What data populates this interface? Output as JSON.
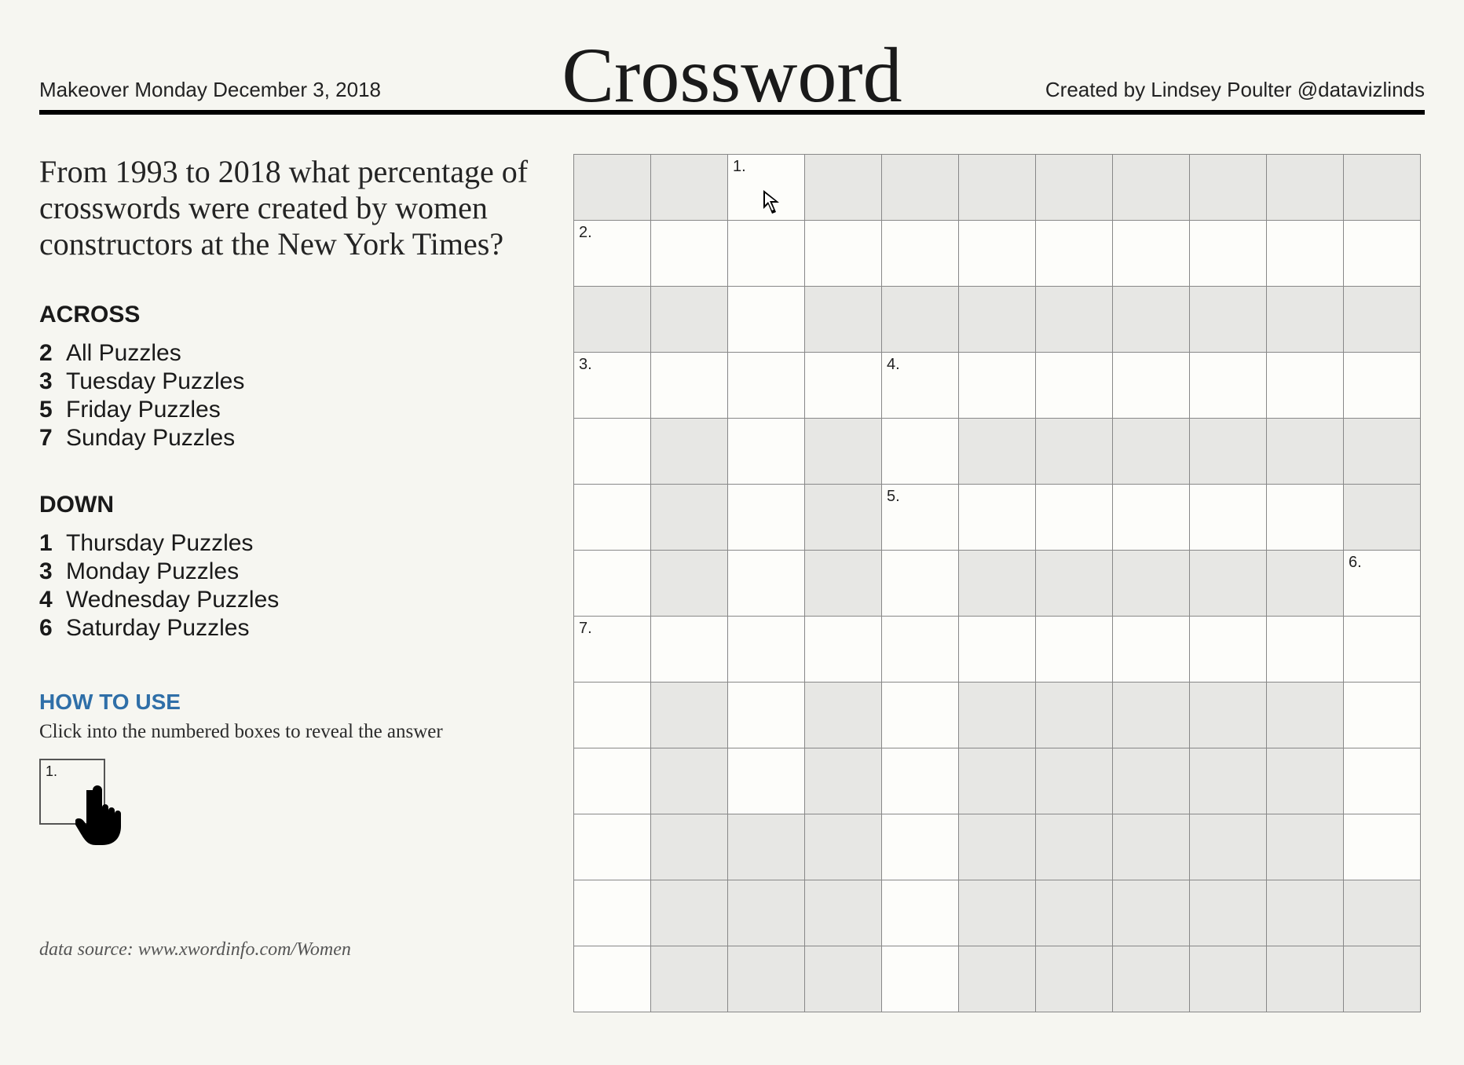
{
  "header": {
    "left": "Makeover Monday December 3, 2018",
    "title": "Crossword",
    "right": "Created by Lindsey Poulter @datavizlinds"
  },
  "question": "From 1993 to 2018 what percentage of crosswords were created by women constructors at the New York Times?",
  "across": {
    "heading": "ACROSS",
    "clues": [
      {
        "num": "2",
        "text": "All Puzzles"
      },
      {
        "num": "3",
        "text": "Tuesday Puzzles"
      },
      {
        "num": "5",
        "text": "Friday Puzzles"
      },
      {
        "num": "7",
        "text": "Sunday Puzzles"
      }
    ]
  },
  "down": {
    "heading": "DOWN",
    "clues": [
      {
        "num": "1",
        "text": "Thursday Puzzles"
      },
      {
        "num": "3",
        "text": "Monday Puzzles"
      },
      {
        "num": "4",
        "text": "Wednesday Puzzles"
      },
      {
        "num": "6",
        "text": "Saturday Puzzles"
      }
    ]
  },
  "howto": {
    "heading": "HOW TO USE",
    "text": "Click into the numbered boxes to reveal the answer",
    "example_num": "1."
  },
  "source": "data source: www.xwordinfo.com/Women",
  "grid": {
    "cols": 11,
    "rows": 13,
    "cells": [
      [
        {
          "s": 1
        },
        {
          "s": 1
        },
        {
          "s": 0,
          "n": "1."
        },
        {
          "s": 1
        },
        {
          "s": 1
        },
        {
          "s": 1
        },
        {
          "s": 1
        },
        {
          "s": 1
        },
        {
          "s": 1
        },
        {
          "s": 1
        },
        {
          "s": 1
        }
      ],
      [
        {
          "s": 0,
          "n": "2."
        },
        {
          "s": 0
        },
        {
          "s": 0
        },
        {
          "s": 0
        },
        {
          "s": 0
        },
        {
          "s": 0
        },
        {
          "s": 0
        },
        {
          "s": 0
        },
        {
          "s": 0
        },
        {
          "s": 0
        },
        {
          "s": 0
        }
      ],
      [
        {
          "s": 1
        },
        {
          "s": 1
        },
        {
          "s": 0
        },
        {
          "s": 1
        },
        {
          "s": 1
        },
        {
          "s": 1
        },
        {
          "s": 1
        },
        {
          "s": 1
        },
        {
          "s": 1
        },
        {
          "s": 1
        },
        {
          "s": 1
        }
      ],
      [
        {
          "s": 0,
          "n": "3."
        },
        {
          "s": 0
        },
        {
          "s": 0
        },
        {
          "s": 0
        },
        {
          "s": 0,
          "n": "4."
        },
        {
          "s": 0
        },
        {
          "s": 0
        },
        {
          "s": 0
        },
        {
          "s": 0
        },
        {
          "s": 0
        },
        {
          "s": 0
        }
      ],
      [
        {
          "s": 0
        },
        {
          "s": 1
        },
        {
          "s": 0
        },
        {
          "s": 1
        },
        {
          "s": 0
        },
        {
          "s": 1
        },
        {
          "s": 1
        },
        {
          "s": 1
        },
        {
          "s": 1
        },
        {
          "s": 1
        },
        {
          "s": 1
        }
      ],
      [
        {
          "s": 0
        },
        {
          "s": 1
        },
        {
          "s": 0
        },
        {
          "s": 1
        },
        {
          "s": 0,
          "n": "5."
        },
        {
          "s": 0
        },
        {
          "s": 0
        },
        {
          "s": 0
        },
        {
          "s": 0
        },
        {
          "s": 0
        },
        {
          "s": 1
        }
      ],
      [
        {
          "s": 0
        },
        {
          "s": 1
        },
        {
          "s": 0
        },
        {
          "s": 1
        },
        {
          "s": 0
        },
        {
          "s": 1
        },
        {
          "s": 1
        },
        {
          "s": 1
        },
        {
          "s": 1
        },
        {
          "s": 1
        },
        {
          "s": 0,
          "n": "6."
        }
      ],
      [
        {
          "s": 0,
          "n": "7."
        },
        {
          "s": 0
        },
        {
          "s": 0
        },
        {
          "s": 0
        },
        {
          "s": 0
        },
        {
          "s": 0
        },
        {
          "s": 0
        },
        {
          "s": 0
        },
        {
          "s": 0
        },
        {
          "s": 0
        },
        {
          "s": 0
        }
      ],
      [
        {
          "s": 0
        },
        {
          "s": 1
        },
        {
          "s": 0
        },
        {
          "s": 1
        },
        {
          "s": 0
        },
        {
          "s": 1
        },
        {
          "s": 1
        },
        {
          "s": 1
        },
        {
          "s": 1
        },
        {
          "s": 1
        },
        {
          "s": 0
        }
      ],
      [
        {
          "s": 0
        },
        {
          "s": 1
        },
        {
          "s": 0
        },
        {
          "s": 1
        },
        {
          "s": 0
        },
        {
          "s": 1
        },
        {
          "s": 1
        },
        {
          "s": 1
        },
        {
          "s": 1
        },
        {
          "s": 1
        },
        {
          "s": 0
        }
      ],
      [
        {
          "s": 0
        },
        {
          "s": 1
        },
        {
          "s": 1
        },
        {
          "s": 1
        },
        {
          "s": 0
        },
        {
          "s": 1
        },
        {
          "s": 1
        },
        {
          "s": 1
        },
        {
          "s": 1
        },
        {
          "s": 1
        },
        {
          "s": 0
        }
      ],
      [
        {
          "s": 0
        },
        {
          "s": 1
        },
        {
          "s": 1
        },
        {
          "s": 1
        },
        {
          "s": 0
        },
        {
          "s": 1
        },
        {
          "s": 1
        },
        {
          "s": 1
        },
        {
          "s": 1
        },
        {
          "s": 1
        },
        {
          "s": 1
        }
      ],
      [
        {
          "s": 0
        },
        {
          "s": 1
        },
        {
          "s": 1
        },
        {
          "s": 1
        },
        {
          "s": 0
        },
        {
          "s": 1
        },
        {
          "s": 1
        },
        {
          "s": 1
        },
        {
          "s": 1
        },
        {
          "s": 1
        },
        {
          "s": 1
        }
      ]
    ]
  }
}
